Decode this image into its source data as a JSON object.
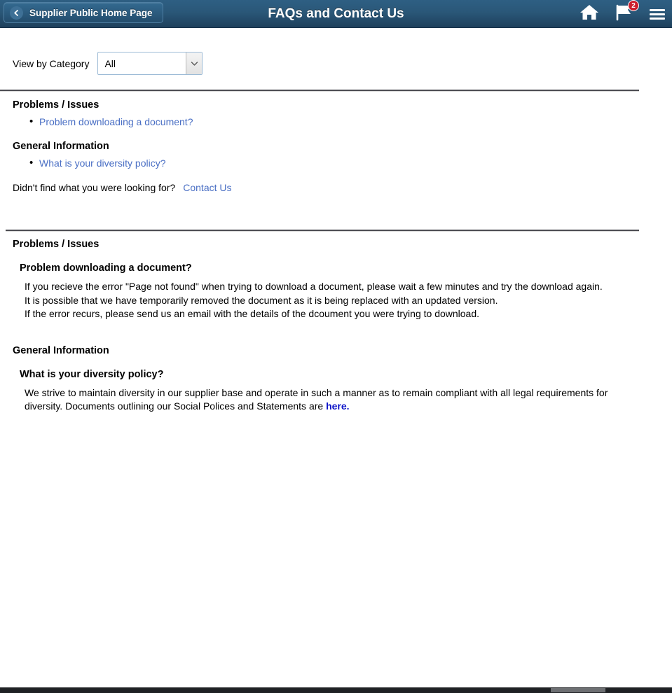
{
  "header": {
    "back_label": "Supplier Public Home Page",
    "title": "FAQs and Contact Us",
    "home_icon": "home-icon",
    "flag_icon": "flag-icon",
    "notification_count": "2",
    "menu_icon": "hamburger-menu-icon",
    "back_icon": "chevron-left-icon"
  },
  "filter": {
    "label": "View by Category",
    "selected": "All",
    "arrow_icon": "chevron-down-icon"
  },
  "index": {
    "categories": [
      {
        "name": "Problems / Issues",
        "questions": [
          "Problem downloading a document?"
        ]
      },
      {
        "name": "General Information",
        "questions": [
          "What is your diversity policy?"
        ]
      }
    ],
    "notfound_text": "Didn't find what you were looking for?",
    "contact_link": "Contact Us"
  },
  "answers": {
    "groups": [
      {
        "category": "Problems / Issues",
        "items": [
          {
            "question": "Problem downloading a document?",
            "lines": [
              "If you recieve the error \"Page not found\" when trying to download a document, please wait a few minutes and try the download again.",
              "It is possible that we have temporarily removed the document as it is being replaced with an updated version.",
              "If the error recurs, please send us an email with the details of the dcoument you were trying to download."
            ]
          }
        ]
      },
      {
        "category": "General Information",
        "items": [
          {
            "question": "What is your diversity policy?",
            "text_before_link": "We strive to maintain diversity in our supplier base and operate in such a manner as to remain compliant with all legal requirements for diversity. Documents outlining our Social Polices and Statements are ",
            "link_text": "here."
          }
        ]
      }
    ]
  },
  "colors": {
    "header_top": "#2e5f83",
    "header_bottom": "#1e405c",
    "link_blue": "#4a6fc4",
    "strong_link_blue": "#0e14c8",
    "badge_red": "#cc1f2d",
    "rule_gray": "#4c4c52"
  }
}
